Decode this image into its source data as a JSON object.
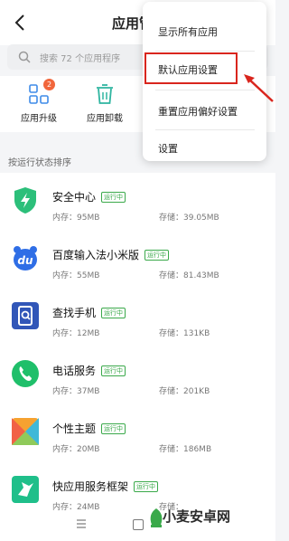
{
  "header": {
    "title": "应用管理",
    "back_icon": "chevron-left-icon"
  },
  "search": {
    "placeholder": "搜索 72 个应用程序",
    "icon": "search-icon"
  },
  "quick_actions": [
    {
      "label": "应用升级",
      "icon": "grid-apps-icon",
      "badge": "2"
    },
    {
      "label": "应用卸载",
      "icon": "trash-icon"
    }
  ],
  "sort_label": "按运行状态排序",
  "menu": {
    "items": [
      "显示所有应用",
      "默认应用设置",
      "重置应用偏好设置",
      "设置"
    ],
    "highlighted": "默认应用设置"
  },
  "status_running": "运行中",
  "apps": [
    {
      "name": "安全中心",
      "running": true,
      "memory": "内存：95MB",
      "storage": "存储：39.05MB",
      "icon": "shield-icon"
    },
    {
      "name": "百度输入法小米版",
      "running": true,
      "memory": "内存：55MB",
      "storage": "存储：81.43MB",
      "icon": "du-keyboard-icon"
    },
    {
      "name": "查找手机",
      "running": true,
      "memory": "内存：12MB",
      "storage": "存储：131KB",
      "icon": "find-phone-icon"
    },
    {
      "name": "电话服务",
      "running": true,
      "memory": "内存：37MB",
      "storage": "存储：201KB",
      "icon": "phone-icon"
    },
    {
      "name": "个性主题",
      "running": true,
      "memory": "内存：20MB",
      "storage": "存储：186MB",
      "icon": "themes-icon"
    },
    {
      "name": "快应用服务框架",
      "running": true,
      "memory": "内存：24MB",
      "storage": "存储：",
      "icon": "bird-icon"
    }
  ],
  "watermark": "小麦安卓网",
  "colors": {
    "accent_green": "#3aa94a",
    "highlight_red": "#d9251d",
    "badge_orange": "#f1663c"
  }
}
